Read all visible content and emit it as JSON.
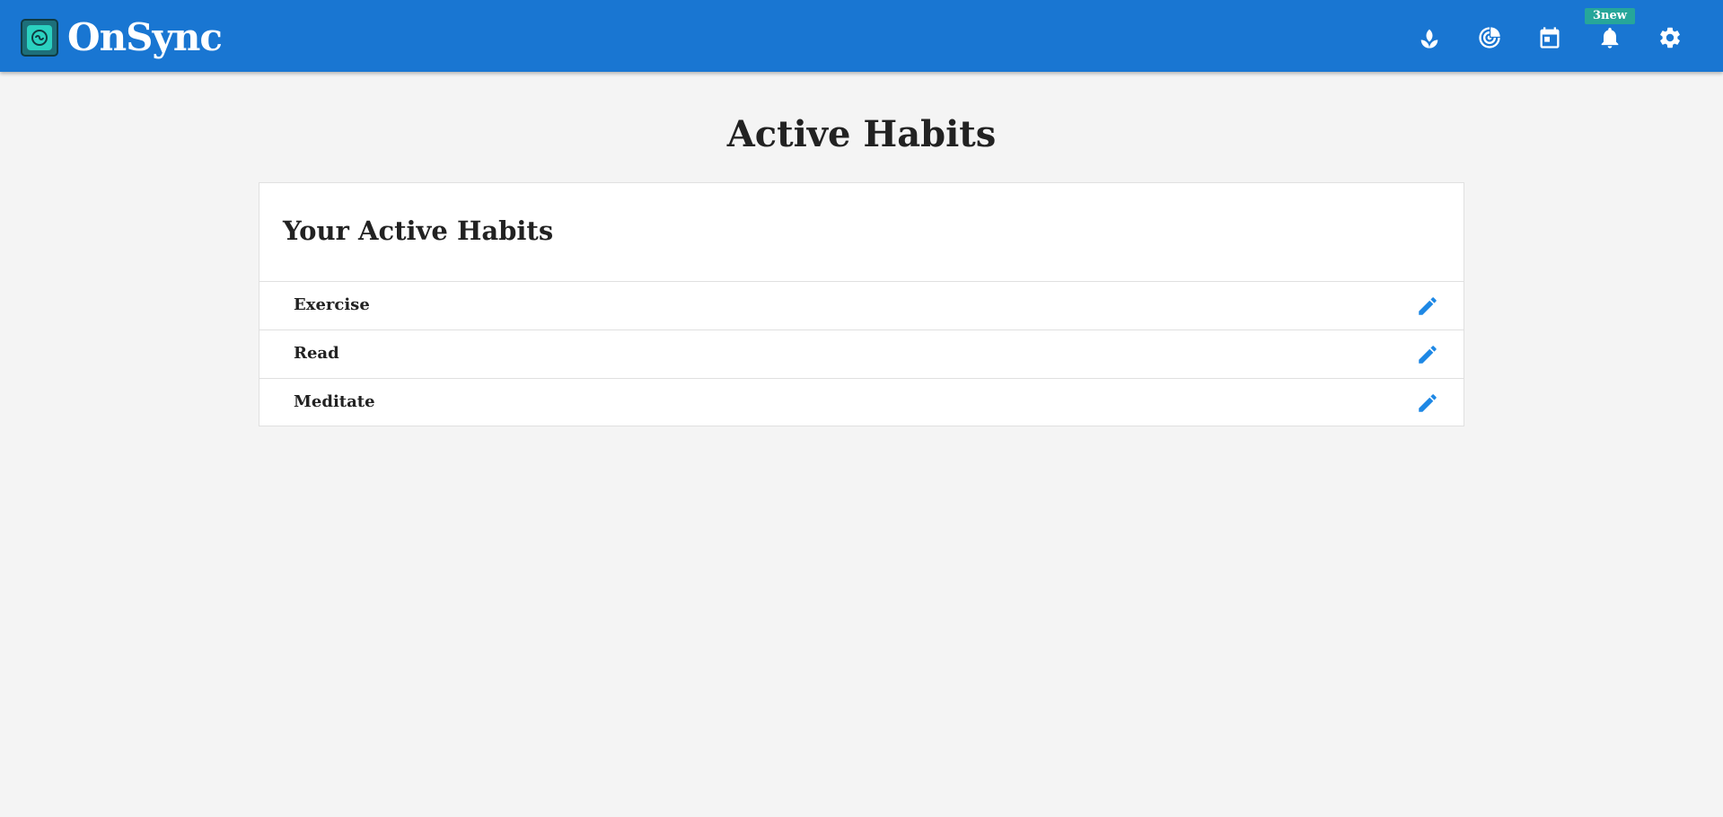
{
  "app": {
    "name": "OnSync",
    "accent_color": "#1976d2",
    "logo_icon": "onsync-logo-icon"
  },
  "navbar": {
    "icons": [
      {
        "name": "sprout-icon"
      },
      {
        "name": "target-icon"
      },
      {
        "name": "calendar-icon"
      },
      {
        "name": "bell-icon"
      },
      {
        "name": "gear-icon"
      }
    ],
    "notification_badge": "3new",
    "badge_color": "#26a69a"
  },
  "page": {
    "title": "Active Habits"
  },
  "card": {
    "title": "Your Active Habits",
    "habits": [
      {
        "name": "Exercise",
        "action_icon": "pencil-icon"
      },
      {
        "name": "Read",
        "action_icon": "pencil-icon"
      },
      {
        "name": "Meditate",
        "action_icon": "pencil-icon"
      }
    ],
    "action_color": "#1e88e5"
  }
}
